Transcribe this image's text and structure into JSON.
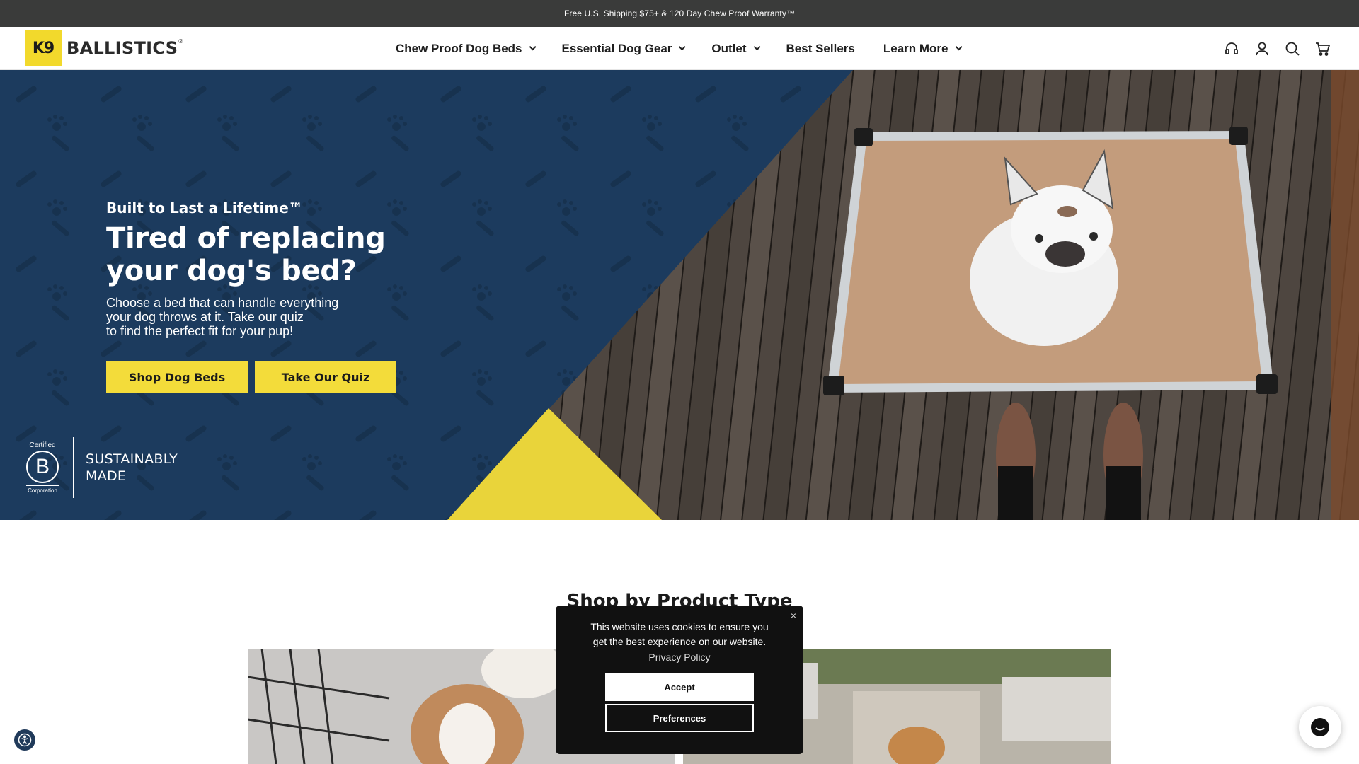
{
  "announcement": {
    "text": "Free U.S. Shipping $75+ & 120 Day Chew Proof Warranty™"
  },
  "logo": {
    "mark": "K9",
    "wordmark": "BALLISTICS",
    "registered": "®"
  },
  "nav": {
    "items": [
      {
        "label": "Chew Proof Dog Beds",
        "has_dropdown": true
      },
      {
        "label": "Essential Dog Gear",
        "has_dropdown": true
      },
      {
        "label": "Outlet",
        "has_dropdown": true
      },
      {
        "label": "Best Sellers",
        "has_dropdown": false
      },
      {
        "label": "Learn More",
        "has_dropdown": true
      }
    ]
  },
  "header_icons": [
    "support-icon",
    "account-icon",
    "search-icon",
    "cart-icon"
  ],
  "hero": {
    "eyebrow": "Built to Last a Lifetime™",
    "headline_line1": "Tired of replacing",
    "headline_line2": "your dog's bed?",
    "sub_line1": "Choose a bed that can handle everything",
    "sub_line2": "your dog throws at it. Take our quiz",
    "sub_line3": "to find the perfect fit for your pup!",
    "cta_primary": "Shop Dog Beds",
    "cta_secondary": "Take Our Quiz",
    "badge": {
      "certified": "Certified",
      "letter": "B",
      "corporation": "Corporation",
      "line1": "SUSTAINABLY",
      "line2": "MADE"
    }
  },
  "section": {
    "title": "Shop by Product Type"
  },
  "cookie": {
    "close": "×",
    "message": "This website uses cookies to ensure you get the best experience on our website.",
    "policy_link": "Privacy Policy",
    "accept": "Accept",
    "preferences": "Preferences"
  },
  "colors": {
    "announce_bg": "#3a3b3a",
    "navy": "#1c3b5e",
    "yellow": "#f3dc3a",
    "cookie_bg": "#111111"
  }
}
